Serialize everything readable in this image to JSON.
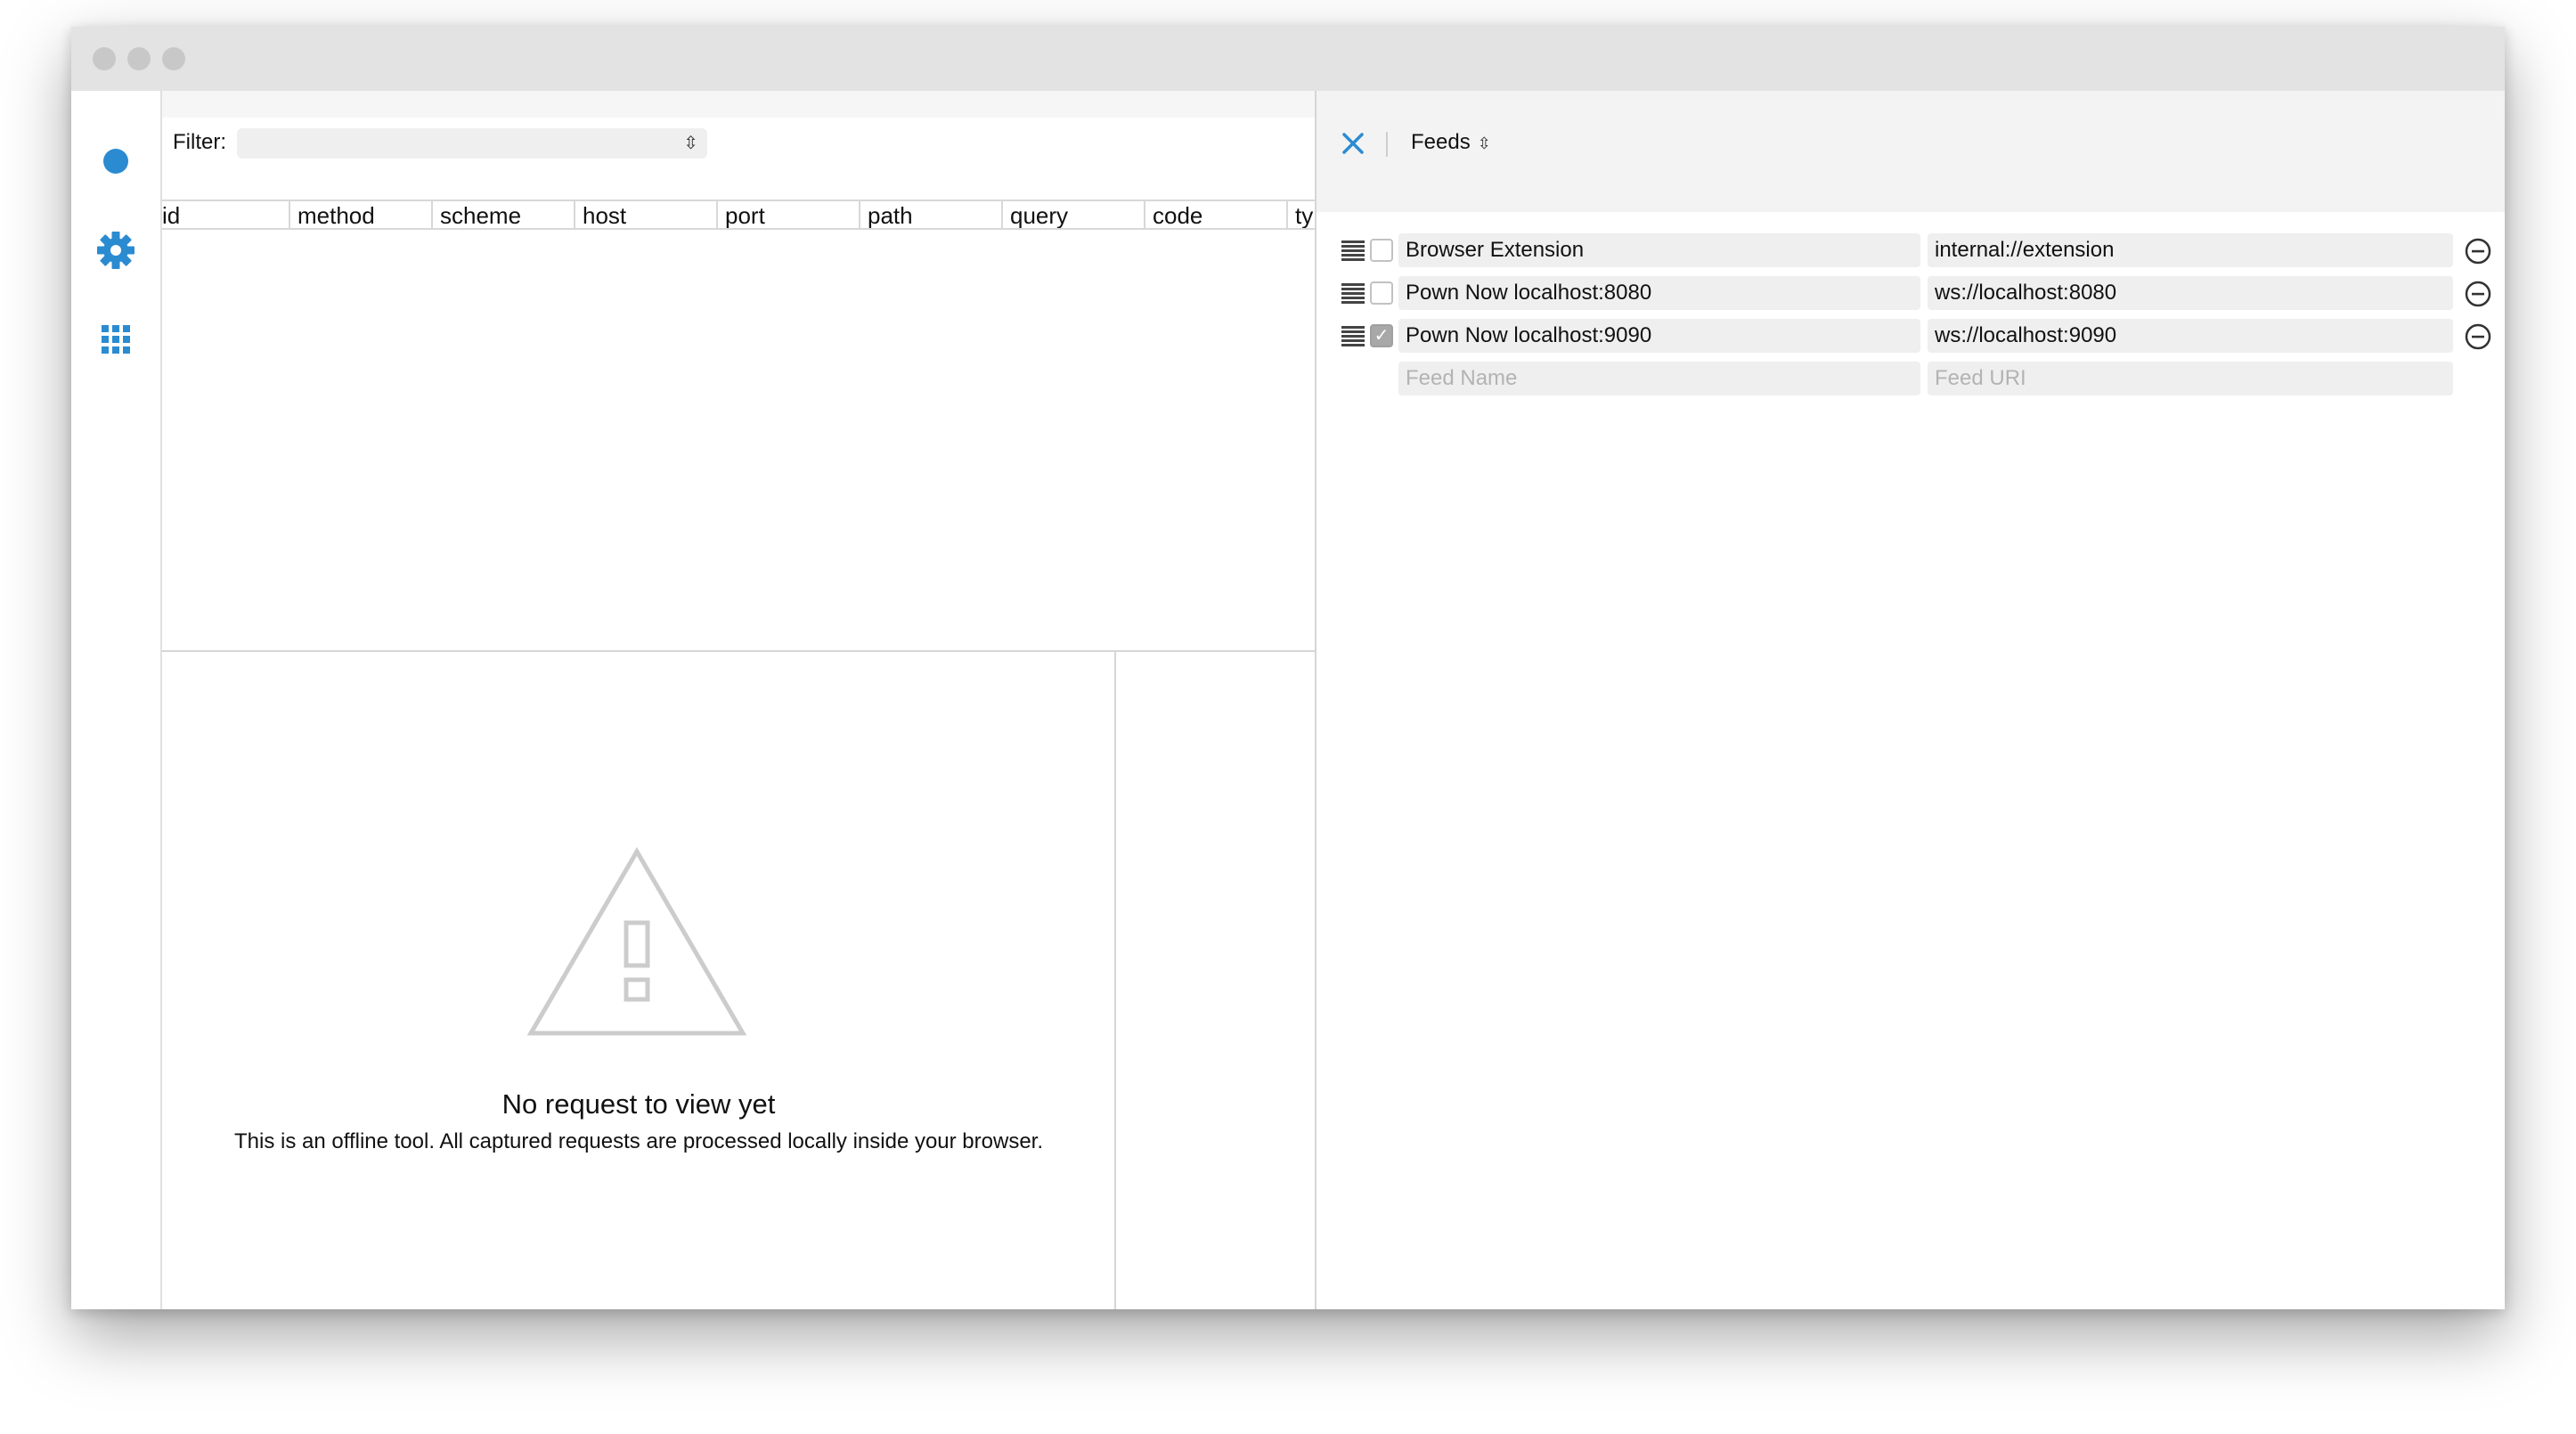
{
  "filter": {
    "label": "Filter:",
    "value": ""
  },
  "table": {
    "columns": [
      "id",
      "method",
      "scheme",
      "host",
      "port",
      "path",
      "query",
      "code",
      "ty"
    ]
  },
  "viewer": {
    "empty_title": "No request to view yet",
    "empty_subtitle": "This is an offline tool. All captured requests are processed locally inside your browser."
  },
  "panel": {
    "selector_label": "Feeds",
    "feeds": [
      {
        "name": "Browser Extension",
        "uri": "internal://extension",
        "enabled": false
      },
      {
        "name": "Pown Now localhost:8080",
        "uri": "ws://localhost:8080",
        "enabled": false
      },
      {
        "name": "Pown Now localhost:9090",
        "uri": "ws://localhost:9090",
        "enabled": true
      }
    ],
    "new_feed": {
      "name_placeholder": "Feed Name",
      "uri_placeholder": "Feed URI"
    }
  },
  "sidebar": {
    "icons": [
      "record-icon",
      "gear-icon",
      "apps-grid-icon"
    ]
  },
  "colors": {
    "accent": "#2b8bd1",
    "checkbox_checked": "#a8a8a8"
  }
}
